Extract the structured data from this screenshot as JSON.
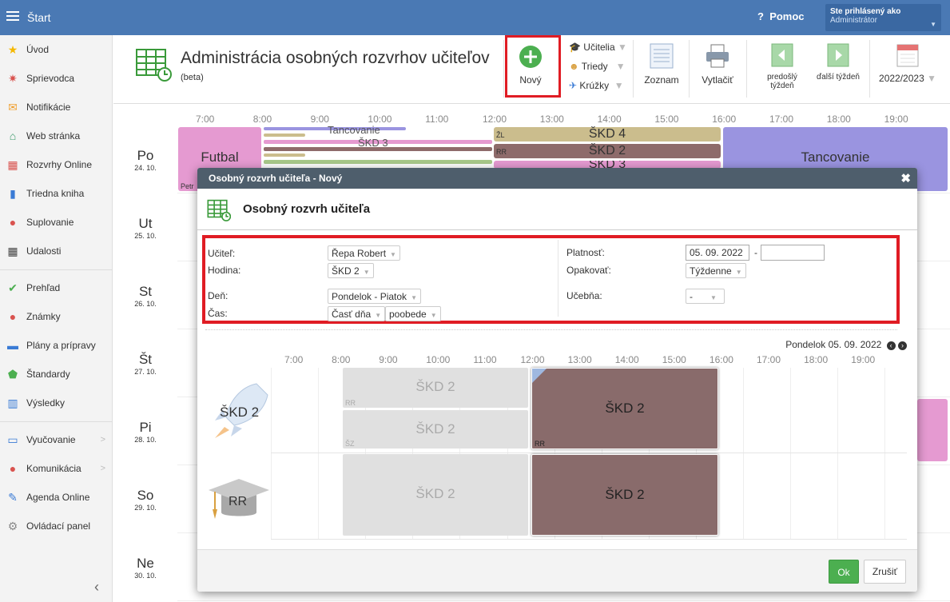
{
  "topbar": {
    "start": "Štart",
    "help": "Pomoc",
    "user_title": "Ste prihlásený ako",
    "user_role": "Administrátor"
  },
  "sidebar": {
    "items": [
      {
        "label": "Úvod",
        "icon": "star-icon"
      },
      {
        "label": "Sprievodca",
        "icon": "wand-icon"
      },
      {
        "label": "Notifikácie",
        "icon": "envelope-icon"
      },
      {
        "label": "Web stránka",
        "icon": "home-icon"
      },
      {
        "label": "Rozvrhy Online",
        "icon": "calendar-grid-icon"
      },
      {
        "label": "Triedna kniha",
        "icon": "book-icon"
      },
      {
        "label": "Suplovanie",
        "icon": "person-icon"
      },
      {
        "label": "Udalosti",
        "icon": "calendar-icon"
      },
      {
        "label": "Prehľad",
        "icon": "check-circle-icon"
      },
      {
        "label": "Známky",
        "icon": "grade-icon"
      },
      {
        "label": "Plány a prípravy",
        "icon": "briefcase-icon"
      },
      {
        "label": "Štandardy",
        "icon": "shield-icon"
      },
      {
        "label": "Výsledky",
        "icon": "bar-chart-icon"
      },
      {
        "label": "Vyučovanie",
        "icon": "open-book-icon"
      },
      {
        "label": "Komunikácia",
        "icon": "chat-icon"
      },
      {
        "label": "Agenda Online",
        "icon": "pen-icon"
      },
      {
        "label": "Ovládací panel",
        "icon": "gear-icon"
      }
    ]
  },
  "header": {
    "title": "Administrácia osobných rozvrhov učiteľov",
    "subtitle": "(beta)",
    "new_label": "Nový",
    "teachers": "Učitelia",
    "classes": "Triedy",
    "clubs": "Krúžky",
    "list": "Zoznam",
    "print": "Vytlačiť",
    "prev_week": "predošlý týždeň",
    "next_week": "ďalší týždeň",
    "year": "2022/2023"
  },
  "schedule": {
    "hours": [
      "7:00",
      "8:00",
      "9:00",
      "10:00",
      "11:00",
      "12:00",
      "13:00",
      "14:00",
      "15:00",
      "16:00",
      "17:00",
      "18:00",
      "19:00"
    ],
    "days": [
      {
        "name": "Po",
        "date": "24. 10."
      },
      {
        "name": "Ut",
        "date": "25. 10."
      },
      {
        "name": "St",
        "date": "26. 10."
      },
      {
        "name": "Št",
        "date": "27. 10."
      },
      {
        "name": "Pi",
        "date": "28. 10."
      },
      {
        "name": "So",
        "date": "29. 10."
      },
      {
        "name": "Ne",
        "date": "30. 10."
      }
    ],
    "blocks": {
      "futbal": "Futbal",
      "futbal_teacher": "Petr",
      "skd4": "ŠKD 4",
      "skd4_tag": "ŽL",
      "skd2": "ŠKD 2",
      "skd2_tag": "RR",
      "skd3": "ŠKD 3",
      "tancovanie": "Tancovanie",
      "tancovanie_small": "Tancovanie",
      "skd3_small": "ŠKD 3"
    }
  },
  "modal": {
    "title": "Osobný rozvrh učiteľa - Nový",
    "heading": "Osobný rozvrh učiteľa",
    "form": {
      "teacher_label": "Učiteľ:",
      "teacher_value": "Řepa Robert",
      "hour_label": "Hodina:",
      "hour_value": "ŠKD 2",
      "day_label": "Deň:",
      "day_value": "Pondelok - Piatok",
      "time_label": "Čas:",
      "time_value1": "Časť dňa",
      "time_value2": "poobede",
      "validity_label": "Platnosť:",
      "validity_from": "05. 09. 2022",
      "validity_sep": "-",
      "validity_to": "",
      "repeat_label": "Opakovať:",
      "repeat_value": "Týždenne",
      "room_label": "Učebňa:",
      "room_value": "-"
    },
    "nav_date": "Pondelok 05. 09. 2022",
    "grid_hours": [
      "7:00",
      "8:00",
      "9:00",
      "10:00",
      "11:00",
      "12:00",
      "13:00",
      "14:00",
      "15:00",
      "16:00",
      "17:00",
      "18:00",
      "19:00"
    ],
    "rows": [
      {
        "label": "ŠKD 2",
        "cells": [
          {
            "text": "ŠKD 2",
            "tag": "RR"
          },
          {
            "text": "ŠKD 2",
            "tag": "ŠZ"
          },
          {
            "text": "ŠKD 2",
            "tag": "RR"
          }
        ]
      },
      {
        "label": "RR",
        "cells": [
          {
            "text": "ŠKD 2",
            "tag": ""
          },
          {
            "text": "ŠKD 2",
            "tag": ""
          }
        ]
      }
    ],
    "ok": "Ok",
    "cancel": "Zrušiť"
  },
  "colors": {
    "topbar": "#4a79b4",
    "pink": "#e59ad1",
    "tan": "#cbbd8d",
    "brown": "#8e6b6b",
    "lavender": "#9a94e0",
    "selected": "#896b6b",
    "gray": "#e0e0e0",
    "ok": "#4caf50",
    "highlight": "#e01c24"
  }
}
